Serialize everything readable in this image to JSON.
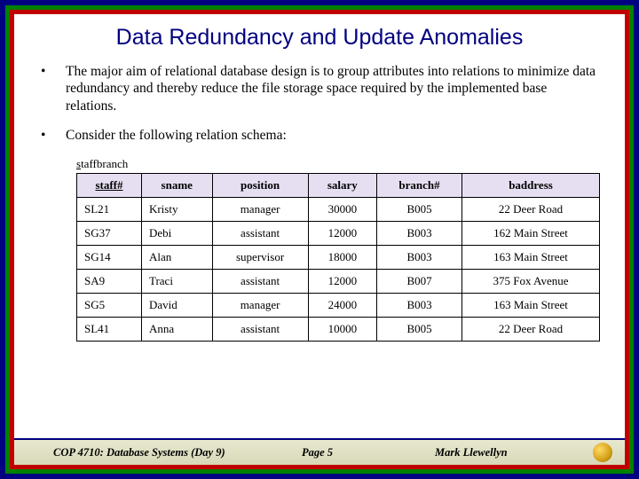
{
  "title": "Data Redundancy and Update Anomalies",
  "bullets": [
    "The major aim of relational database design is to group attributes into relations to minimize data redundancy and thereby reduce the file storage space required by the implemented base relations.",
    "Consider the following relation schema:"
  ],
  "relation_name_prefix": "s",
  "relation_name_rest": "taffbranch",
  "table": {
    "headers": [
      "staff#",
      "sname",
      "position",
      "salary",
      "branch#",
      "baddress"
    ],
    "rows": [
      [
        "SL21",
        "Kristy",
        "manager",
        "30000",
        "B005",
        "22 Deer Road"
      ],
      [
        "SG37",
        "Debi",
        "assistant",
        "12000",
        "B003",
        "162 Main Street"
      ],
      [
        "SG14",
        "Alan",
        "supervisor",
        "18000",
        "B003",
        "163 Main Street"
      ],
      [
        "SA9",
        "Traci",
        "assistant",
        "12000",
        "B007",
        "375 Fox Avenue"
      ],
      [
        "SG5",
        "David",
        "manager",
        "24000",
        "B003",
        "163 Main Street"
      ],
      [
        "SL41",
        "Anna",
        "assistant",
        "10000",
        "B005",
        "22 Deer Road"
      ]
    ]
  },
  "footer": {
    "course": "COP 4710: Database Systems  (Day 9)",
    "page": "Page 5",
    "author": "Mark Llewellyn"
  },
  "chart_data": {
    "type": "table",
    "title": "staffbranch",
    "columns": [
      "staff#",
      "sname",
      "position",
      "salary",
      "branch#",
      "baddress"
    ],
    "rows": [
      {
        "staff#": "SL21",
        "sname": "Kristy",
        "position": "manager",
        "salary": 30000,
        "branch#": "B005",
        "baddress": "22 Deer Road"
      },
      {
        "staff#": "SG37",
        "sname": "Debi",
        "position": "assistant",
        "salary": 12000,
        "branch#": "B003",
        "baddress": "162 Main Street"
      },
      {
        "staff#": "SG14",
        "sname": "Alan",
        "position": "supervisor",
        "salary": 18000,
        "branch#": "B003",
        "baddress": "163 Main Street"
      },
      {
        "staff#": "SA9",
        "sname": "Traci",
        "position": "assistant",
        "salary": 12000,
        "branch#": "B007",
        "baddress": "375 Fox Avenue"
      },
      {
        "staff#": "SG5",
        "sname": "David",
        "position": "manager",
        "salary": 24000,
        "branch#": "B003",
        "baddress": "163 Main Street"
      },
      {
        "staff#": "SL41",
        "sname": "Anna",
        "position": "assistant",
        "salary": 10000,
        "branch#": "B005",
        "baddress": "22 Deer Road"
      }
    ]
  }
}
